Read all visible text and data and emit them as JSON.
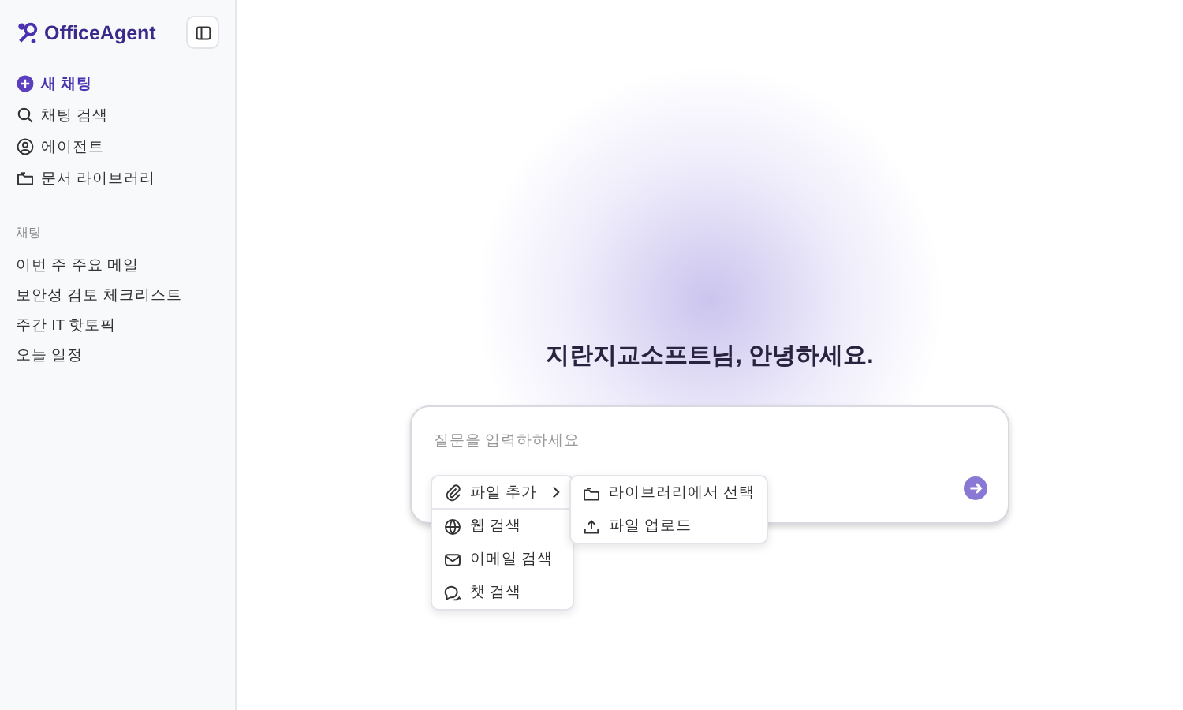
{
  "sidebar": {
    "logo": "OfficeAgent",
    "nav": [
      {
        "label": "새 채팅",
        "selected": true
      },
      {
        "label": "채팅 검색",
        "selected": false
      },
      {
        "label": "에이전트",
        "selected": false
      },
      {
        "label": "문서 라이브러리",
        "selected": false
      }
    ],
    "recents_heading": "채팅",
    "recents": [
      "이번 주 주요 메일",
      "보안성 검토 체크리스트",
      "주간 IT 핫토픽",
      "오늘 일정"
    ]
  },
  "main": {
    "greeting": "지란지교소프트님, 안녕하세요.",
    "input": {
      "placeholder": "질문을 입력하하세요"
    },
    "menu": [
      {
        "label": "파일 추가",
        "expanded": true,
        "submenu": [
          {
            "label": "라이브러리에서 선택"
          },
          {
            "label": "파일 업로드"
          }
        ]
      },
      {
        "label": "웹 검색",
        "expanded": false
      },
      {
        "label": "이메일 검색",
        "expanded": false
      },
      {
        "label": "챗 검색",
        "expanded": false
      }
    ]
  }
}
